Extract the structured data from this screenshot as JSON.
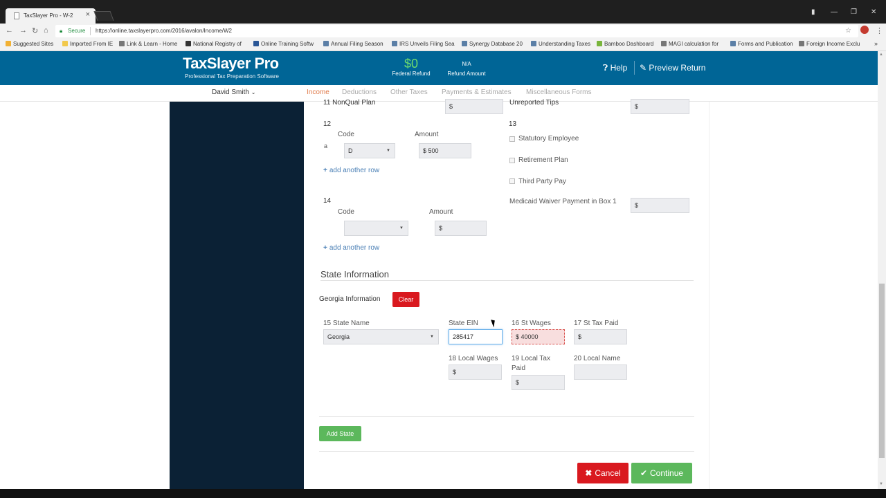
{
  "browser": {
    "tab_title": "TaxSlayer Pro - W-2",
    "secure_label": "Secure",
    "url": "https://online.taxslayerpro.com/2016/avalon/Income/W2",
    "bookmarks": [
      {
        "label": "Suggested Sites",
        "color": "#f2b134"
      },
      {
        "label": "Imported From IE",
        "color": "#f2c94c"
      },
      {
        "label": "Link & Learn - Home",
        "color": "#777777"
      },
      {
        "label": "National Registry of",
        "color": "#333333"
      },
      {
        "label": "Online Training Softw",
        "color": "#2b5797"
      },
      {
        "label": "Annual Filing Season",
        "color": "#5b7fa6"
      },
      {
        "label": "IRS Unveils Filing Sea",
        "color": "#5b7fa6"
      },
      {
        "label": "Synergy Database 20",
        "color": "#5b7fa6"
      },
      {
        "label": "Understanding Taxes",
        "color": "#5b7fa6"
      },
      {
        "label": "Bamboo Dashboard",
        "color": "#79b53c"
      },
      {
        "label": "MAGI calculation for",
        "color": "#777777"
      },
      {
        "label": "Forms and Publication",
        "color": "#5b7fa6"
      },
      {
        "label": "Foreign Income Exclu",
        "color": "#777777"
      }
    ]
  },
  "header": {
    "logo_title": "TaxSlayer Pro",
    "logo_subtitle": "Professional Tax Preparation Software",
    "federal_refund_amount": "$0",
    "federal_refund_label": "Federal Refund",
    "refund_amount_value": "N/A",
    "refund_amount_label": "Refund Amount",
    "help_label": "Help",
    "preview_label": "Preview Return"
  },
  "nav": {
    "user": "David Smith",
    "items": [
      "Income",
      "Deductions",
      "Other Taxes",
      "Payments & Estimates",
      "Miscellaneous Forms"
    ]
  },
  "form": {
    "box11_label": "11 NonQual Plan",
    "box11_value": "$",
    "unreported_tips_label": "Unreported Tips",
    "unreported_tips_value": "$",
    "box12_label": "12",
    "box12_row_letter": "a",
    "code_label": "Code",
    "amount_label": "Amount",
    "box12_code_value": "D",
    "box12_amount_value": "$ 500",
    "add_row_label": "add another row",
    "box13_label": "13",
    "statutory_employee": "Statutory Employee",
    "retirement_plan": "Retirement Plan",
    "third_party_pay": "Third Party Pay",
    "box14_label": "14",
    "box14_code_value": "",
    "box14_amount_value": "$",
    "medicaid_label": "Medicaid Waiver Payment in Box 1",
    "medicaid_value": "$"
  },
  "state": {
    "section_title": "State Information",
    "georgia_label": "Georgia Information",
    "clear_label": "Clear",
    "state_name_label": "15 State Name",
    "state_name_value": "Georgia",
    "state_ein_label": "State EIN",
    "state_ein_value": "285417",
    "st_wages_label": "16 St Wages",
    "st_wages_value": "$ 40000",
    "st_tax_label": "17 St Tax Paid",
    "st_tax_value": "$",
    "local_wages_label": "18 Local Wages",
    "local_wages_value": "$",
    "local_tax_label_1": "19 Local Tax",
    "local_tax_label_2": "Paid",
    "local_tax_value": "$",
    "local_name_label": "20 Local Name",
    "local_name_value": "",
    "add_state_label": "Add State"
  },
  "actions": {
    "cancel_label": "Cancel",
    "continue_label": "Continue"
  },
  "colors": {
    "header_bg": "#006596",
    "sidebar_bg": "#0b2135",
    "refund_green": "#6edb6e",
    "active_nav": "#e07a4a",
    "clear_red": "#d9191f",
    "add_state_green": "#5cb85c",
    "cancel_red": "#d9191f",
    "continue_green": "#5cb85c"
  }
}
